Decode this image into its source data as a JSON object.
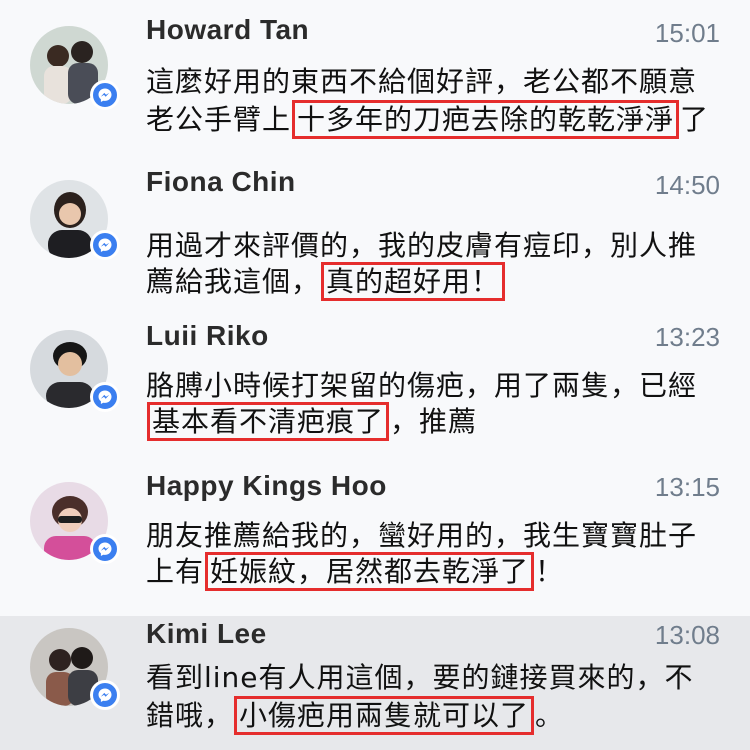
{
  "messages": [
    {
      "name": "Howard Tan",
      "time": "15:01",
      "line1": {
        "pre": "這麼好用的東西不給個好評，老公都不願意",
        "box": "",
        "post": ""
      },
      "line2": {
        "pre": "老公手臂上",
        "box": "十多年的刀疤去除的乾乾淨淨",
        "post": "了"
      },
      "avatar_icon": "couple-photo-icon"
    },
    {
      "name": "Fiona Chin",
      "time": "14:50",
      "line1": {
        "pre": "用過才來評價的，我的皮膚有痘印，別人推",
        "box": "",
        "post": ""
      },
      "line2": {
        "pre": "薦給我這個，",
        "box": "真的超好用！",
        "post": ""
      },
      "avatar_icon": "woman-photo-icon"
    },
    {
      "name": "Luii Riko",
      "time": "13:23",
      "line1": {
        "pre": "胳膊小時候打架留的傷疤，用了兩隻，已經",
        "box": "",
        "post": ""
      },
      "line2": {
        "pre": "",
        "box": "基本看不清疤痕了",
        "post": "，推薦"
      },
      "avatar_icon": "man-photo-icon"
    },
    {
      "name": "Happy Kings Hoo",
      "time": "13:15",
      "line1": {
        "pre": "朋友推薦給我的，蠻好用的，我生寶寶肚子",
        "box": "",
        "post": ""
      },
      "line2": {
        "pre": "上有",
        "box": "妊娠紋，居然都去乾淨了",
        "post": "！"
      },
      "avatar_icon": "woman-sunglasses-photo-icon"
    },
    {
      "name": "Kimi Lee",
      "time": "13:08",
      "line1": {
        "pre": "看到line有人用這個，要的鏈接買來的，不",
        "box": "",
        "post": ""
      },
      "line2": {
        "pre": "錯哦，",
        "box": "小傷疤用兩隻就可以了",
        "post": "。"
      },
      "avatar_icon": "couple-photo-icon"
    }
  ],
  "colors": {
    "highlight_box": "#e52d2d",
    "messenger_badge": "#3b7ff0",
    "time_text": "#707d8c"
  }
}
